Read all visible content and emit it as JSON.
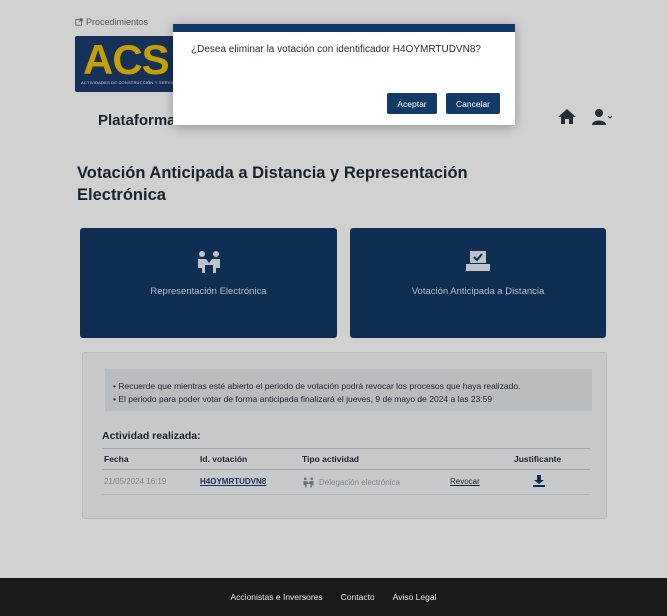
{
  "header": {
    "top_link": "Procedimientos",
    "logo_text": "ACS",
    "logo_subtitle": "ACTIVIDADES DE CONSTRUCCIÓN Y SERVICIOS",
    "platform_title": "Plataforma"
  },
  "page": {
    "title": "Votación Anticipada a Distancia y Representación Electrónica"
  },
  "cards": [
    {
      "label": "Representación Electrónica",
      "icon": "handshake-icon"
    },
    {
      "label": "Votación Anticipada a Distancia",
      "icon": "ballot-box-icon"
    }
  ],
  "notice": {
    "line1": "• Recuerde que mientras esté abierto el periodo de votación podrá revocar los procesos que haya realizado.",
    "line2": "• El periodo para poder votar de forma anticipada finalizará el jueves, 9 de mayo de 2024 a las 23:59"
  },
  "activity": {
    "title": "Actividad realizada:",
    "columns": [
      "Fecha",
      "Id. votación",
      "Tipo actividad",
      "Justificante"
    ],
    "rows": [
      {
        "date": "21/05/2024 16:19",
        "id": "H4OYMRTUDVN8",
        "type": "Delegación electrónica",
        "action": "Revocar"
      }
    ]
  },
  "footer": {
    "links": [
      "Accionistas e Inversores",
      "Contacto",
      "Aviso Legal"
    ]
  },
  "dialog": {
    "message": "¿Desea eliminar la votación con identificador H4OYMRTUDVN8?",
    "accept": "Aceptar",
    "cancel": "Cancelar"
  },
  "colors": {
    "brand_blue": "#123a66",
    "logo_yellow": "#f2c400",
    "footer_bg": "#1a1a1a"
  }
}
